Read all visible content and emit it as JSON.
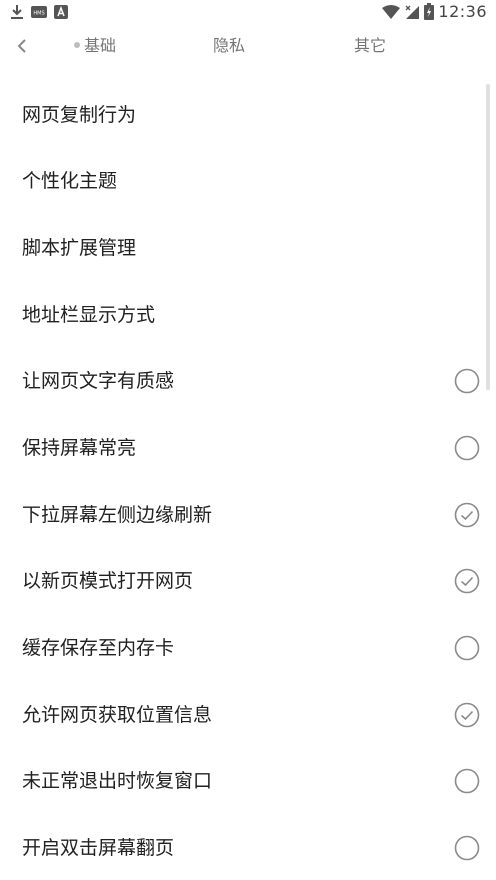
{
  "status_bar": {
    "time": "12:36",
    "hms_badge": "HMS",
    "left_icons": [
      "download-icon",
      "hms-icon",
      "a-icon"
    ],
    "right_icons": [
      "wifi-icon",
      "signal-icon",
      "battery-icon"
    ]
  },
  "nav": {
    "tabs": [
      {
        "label": "基础"
      },
      {
        "label": "隐私"
      },
      {
        "label": "其它"
      }
    ]
  },
  "settings": [
    {
      "label": "网页复制行为",
      "toggle": null
    },
    {
      "label": "个性化主题",
      "toggle": null
    },
    {
      "label": "脚本扩展管理",
      "toggle": null
    },
    {
      "label": "地址栏显示方式",
      "toggle": null
    },
    {
      "label": "让网页文字有质感",
      "toggle": false
    },
    {
      "label": "保持屏幕常亮",
      "toggle": false
    },
    {
      "label": "下拉屏幕左侧边缘刷新",
      "toggle": true
    },
    {
      "label": "以新页模式打开网页",
      "toggle": true
    },
    {
      "label": "缓存保存至内存卡",
      "toggle": false
    },
    {
      "label": "允许网页获取位置信息",
      "toggle": true
    },
    {
      "label": "未正常退出时恢复窗口",
      "toggle": false
    },
    {
      "label": "开启双击屏幕翻页",
      "toggle": false
    }
  ],
  "colors": {
    "text": "#212121",
    "tab_text": "#757575",
    "check_stroke": "#8a8a8a",
    "background": "#ffffff"
  }
}
